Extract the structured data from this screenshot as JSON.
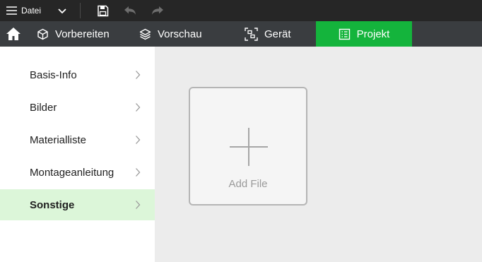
{
  "titlebar": {
    "menu_label": "Datei"
  },
  "tabs": {
    "prepare": "Vorbereiten",
    "preview": "Vorschau",
    "device": "Gerät",
    "project": "Projekt"
  },
  "sidebar": {
    "items": [
      {
        "label": "Basis-Info"
      },
      {
        "label": "Bilder"
      },
      {
        "label": "Materialliste"
      },
      {
        "label": "Montageanleitung"
      },
      {
        "label": "Sonstige"
      }
    ],
    "active_index": 4
  },
  "main": {
    "add_file_label": "Add File"
  },
  "colors": {
    "accent": "#14b43c",
    "active_item_bg": "#dcf6d9",
    "titlebar_bg": "#262626",
    "tabbar_bg": "#3a3d40"
  },
  "icons": [
    "hamburger-icon",
    "chevron-down-icon",
    "save-icon",
    "undo-icon",
    "redo-icon",
    "home-icon",
    "cube-icon",
    "layers-icon",
    "device-icon",
    "project-icon",
    "chevron-right-icon",
    "plus-icon"
  ]
}
